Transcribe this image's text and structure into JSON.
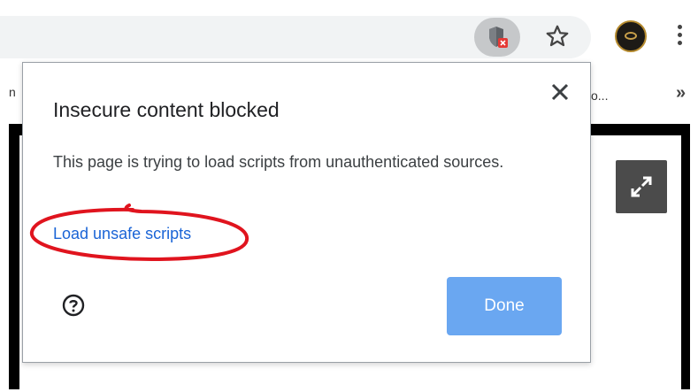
{
  "toolbar": {
    "icons": [
      "shield-blocked-icon",
      "star-icon",
      "profile-avatar",
      "more-menu-icon"
    ]
  },
  "bookmarks": {
    "partial_left": "n",
    "partial_right": "o...",
    "more": "»"
  },
  "dialog": {
    "title": "Insecure content blocked",
    "body": "This page is trying to load scripts from unauthenticated sources.",
    "link": "Load unsafe scripts",
    "done_label": "Done",
    "icons": [
      "close-icon",
      "help-icon"
    ]
  },
  "page": {
    "icons": [
      "expand-icon"
    ]
  },
  "colors": {
    "link": "#1a64d6",
    "done_button": "#6aa7f1",
    "annotation": "#e0141e",
    "blocked_badge": "#e53935"
  }
}
